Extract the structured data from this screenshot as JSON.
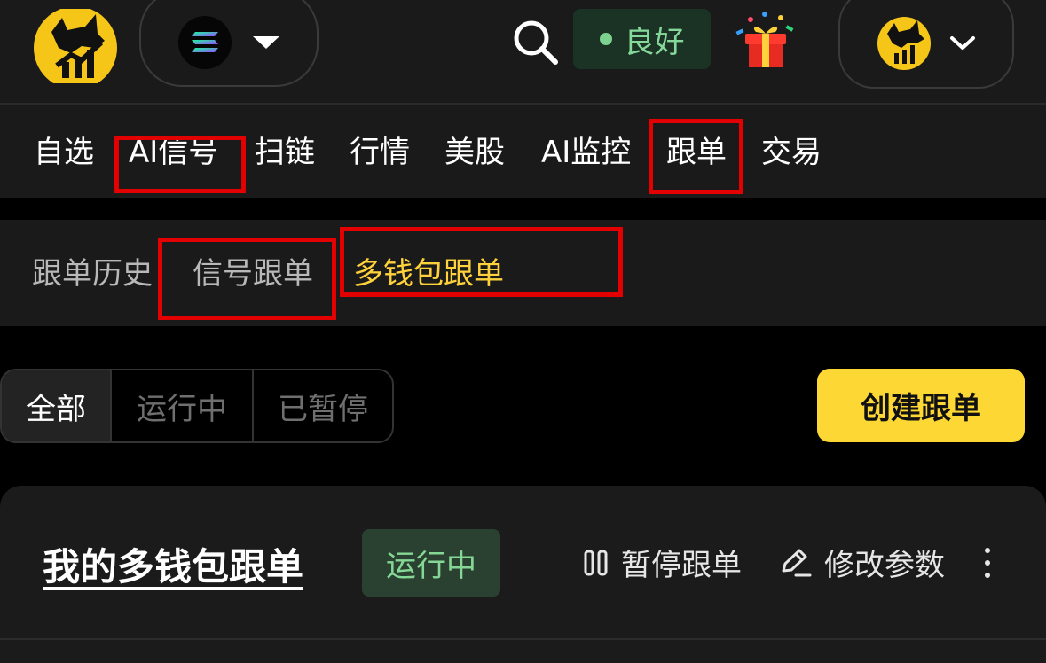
{
  "header": {
    "chain_icon": "solana-icon",
    "status_text": "良好",
    "colors": {
      "brand_yellow": "#f5c518",
      "status_green": "#86d89a",
      "status_bg": "#1b3325",
      "accent_yellow": "#ffd23b",
      "annotation_red": "#e20000"
    }
  },
  "main_nav": {
    "items": [
      "自选",
      "AI信号",
      "扫链",
      "行情",
      "美股",
      "AI监控",
      "跟单",
      "交易"
    ]
  },
  "sub_nav": {
    "items": [
      "跟单历史",
      "信号跟单",
      "多钱包跟单"
    ],
    "active": "多钱包跟单"
  },
  "filter": {
    "segments": [
      "全部",
      "运行中",
      "已暂停"
    ],
    "active": "全部",
    "create_label": "创建跟单"
  },
  "card": {
    "title": "我的多钱包跟单",
    "status": "运行中",
    "pause_label": "暂停跟单",
    "edit_label": "修改参数"
  }
}
